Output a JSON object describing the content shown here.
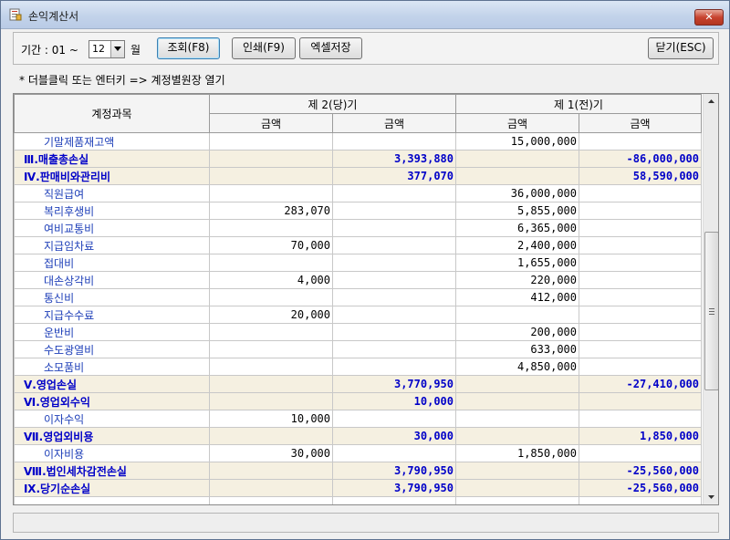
{
  "window": {
    "title": "손익계산서",
    "close_label": "✕"
  },
  "toolbar": {
    "period_label": "기간 : 01 ~",
    "month_value": "12",
    "month_suffix": "월",
    "query_label": "조회(F8)",
    "print_label": "인쇄(F9)",
    "excel_label": "엑셀저장",
    "close_label": "닫기(ESC)"
  },
  "hint": "* 더블클릭 또는 엔터키 => 계정별원장 열기",
  "table": {
    "header_account": "계정과목",
    "header_current": "제 2(당)기",
    "header_prior": "제 1(전)기",
    "subheader": [
      "금액",
      "금액",
      "금액",
      "금액"
    ],
    "rows": [
      {
        "name": "기말제품재고액",
        "type": "detail",
        "c1": "",
        "c2": "",
        "p1": "15,000,000",
        "p2": ""
      },
      {
        "name": "Ⅲ.매출총손실",
        "type": "sum",
        "c1": "",
        "c2": "3,393,880",
        "p1": "",
        "p2": "-86,000,000"
      },
      {
        "name": "Ⅳ.판매비와관리비",
        "type": "sum",
        "c1": "",
        "c2": "377,070",
        "p1": "",
        "p2": "58,590,000"
      },
      {
        "name": "직원급여",
        "type": "detail",
        "c1": "",
        "c2": "",
        "p1": "36,000,000",
        "p2": ""
      },
      {
        "name": "복리후생비",
        "type": "detail",
        "c1": "283,070",
        "c2": "",
        "p1": "5,855,000",
        "p2": ""
      },
      {
        "name": "여비교통비",
        "type": "detail",
        "c1": "",
        "c2": "",
        "p1": "6,365,000",
        "p2": ""
      },
      {
        "name": "지급임차료",
        "type": "detail",
        "c1": "70,000",
        "c2": "",
        "p1": "2,400,000",
        "p2": ""
      },
      {
        "name": "접대비",
        "type": "detail",
        "c1": "",
        "c2": "",
        "p1": "1,655,000",
        "p2": ""
      },
      {
        "name": "대손상각비",
        "type": "detail",
        "c1": "4,000",
        "c2": "",
        "p1": "220,000",
        "p2": ""
      },
      {
        "name": "통신비",
        "type": "detail",
        "c1": "",
        "c2": "",
        "p1": "412,000",
        "p2": ""
      },
      {
        "name": "지급수수료",
        "type": "detail",
        "c1": "20,000",
        "c2": "",
        "p1": "",
        "p2": ""
      },
      {
        "name": "운반비",
        "type": "detail",
        "c1": "",
        "c2": "",
        "p1": "200,000",
        "p2": ""
      },
      {
        "name": "수도광열비",
        "type": "detail",
        "c1": "",
        "c2": "",
        "p1": "633,000",
        "p2": ""
      },
      {
        "name": "소모품비",
        "type": "detail",
        "c1": "",
        "c2": "",
        "p1": "4,850,000",
        "p2": ""
      },
      {
        "name": "Ⅴ.영업손실",
        "type": "sum",
        "c1": "",
        "c2": "3,770,950",
        "p1": "",
        "p2": "-27,410,000"
      },
      {
        "name": "Ⅵ.영업외수익",
        "type": "sum",
        "c1": "",
        "c2": "10,000",
        "p1": "",
        "p2": ""
      },
      {
        "name": "이자수익",
        "type": "detail",
        "c1": "10,000",
        "c2": "",
        "p1": "",
        "p2": ""
      },
      {
        "name": "Ⅶ.영업외비용",
        "type": "sum",
        "c1": "",
        "c2": "30,000",
        "p1": "",
        "p2": "1,850,000"
      },
      {
        "name": "이자비용",
        "type": "detail",
        "c1": "30,000",
        "c2": "",
        "p1": "1,850,000",
        "p2": ""
      },
      {
        "name": "Ⅷ.법인세차감전손실",
        "type": "sum",
        "c1": "",
        "c2": "3,790,950",
        "p1": "",
        "p2": "-25,560,000"
      },
      {
        "name": "Ⅸ.당기순손실",
        "type": "sum",
        "c1": "",
        "c2": "3,790,950",
        "p1": "",
        "p2": "-25,560,000"
      }
    ]
  },
  "icons": {
    "app": "document-icon",
    "scroll_up": "arrow-up-icon",
    "scroll_down": "arrow-down-icon",
    "thumb_grip": "grip-icon"
  },
  "colors": {
    "sum_row_bg": "#f5f0e1",
    "sum_text": "#0000c8",
    "detail_text": "#1e3fb8",
    "close_button": "#c7432f"
  }
}
